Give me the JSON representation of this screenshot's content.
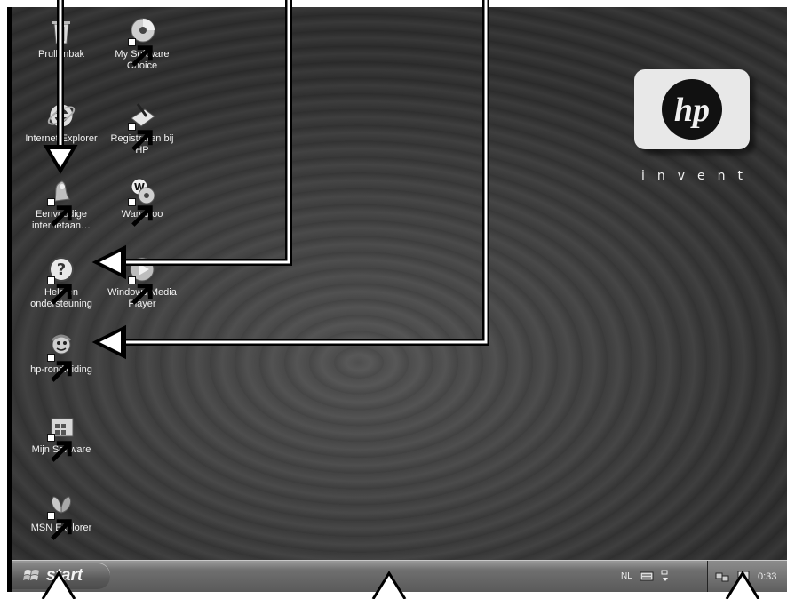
{
  "desktop": {
    "icons": [
      {
        "label": "Prullenbak",
        "icon": "recycle-bin-icon"
      },
      {
        "label": "My Software Choice",
        "icon": "cd-disc-icon"
      },
      {
        "label": "Internet Explorer",
        "icon": "internet-explorer-icon"
      },
      {
        "label": "Registreren bij HP",
        "icon": "register-pen-icon"
      },
      {
        "label": "Eenvoudige internetaan…",
        "icon": "internet-setup-icon"
      },
      {
        "label": "Wanadoo",
        "icon": "wanadoo-icon"
      },
      {
        "label": "Help en ondersteuning",
        "icon": "help-question-icon"
      },
      {
        "label": "Windows Media Player",
        "icon": "media-player-icon"
      },
      {
        "label": "hp-rondleiding",
        "icon": "hp-tour-icon"
      },
      {
        "label": "Mijn Software",
        "icon": "software-folder-icon"
      },
      {
        "label": "MSN Explorer",
        "icon": "msn-butterfly-icon"
      }
    ],
    "brand": {
      "logo_text": "hp",
      "tagline": "invent"
    }
  },
  "taskbar": {
    "start_label": "start",
    "language": "NL",
    "clock": "0:33"
  },
  "colors": {
    "desktop": "#3f3f3f",
    "taskbar": "#6f6f6f",
    "callout": "#ffffff"
  }
}
